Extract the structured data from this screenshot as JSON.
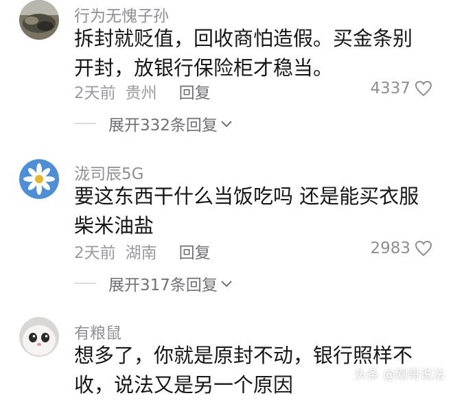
{
  "comments": [
    {
      "username": "行为无愧子孙",
      "text": "拆封就贬值，回收商怕造假。买金条别开封，放银行保险柜才稳当。",
      "time": "2天前",
      "location": "贵州",
      "reply_label": "回复",
      "likes": "4337",
      "expand_label": "展开332条回复",
      "avatar_icon": "landscape-photo-avatar"
    },
    {
      "username": "泷司辰5G",
      "text": "要这东西干什么当饭吃吗 还是能买衣服柴米油盐",
      "time": "2天前",
      "location": "湖南",
      "reply_label": "回复",
      "likes": "2983",
      "expand_label": "展开317条回复",
      "avatar_icon": "daisy-flower-avatar"
    },
    {
      "username": "有粮鼠",
      "text": "想多了，你就是原封不动，银行照样不收，说法又是另一个原因",
      "avatar_icon": "cartoon-bunny-avatar"
    }
  ],
  "watermark": "头条 @刚哥说法",
  "colors": {
    "text": "#161616",
    "muted": "#8e8e93",
    "background": "#ffffff"
  }
}
